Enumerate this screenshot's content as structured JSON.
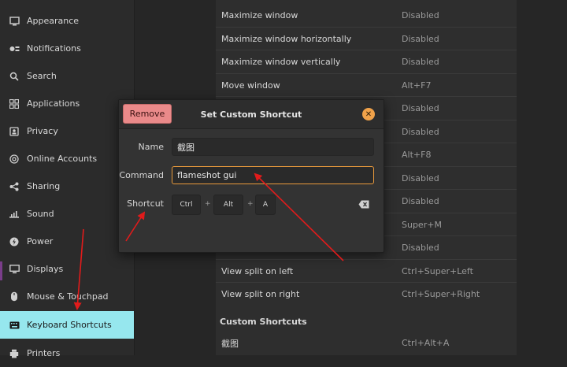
{
  "sidebar": {
    "items": [
      {
        "label": "Appearance",
        "icon": "appearance-icon",
        "active": false
      },
      {
        "label": "Notifications",
        "icon": "notifications-icon",
        "active": false
      },
      {
        "label": "Search",
        "icon": "search-icon",
        "active": false
      },
      {
        "label": "Applications",
        "icon": "applications-icon",
        "active": false
      },
      {
        "label": "Privacy",
        "icon": "privacy-icon",
        "active": false
      },
      {
        "label": "Online Accounts",
        "icon": "at-icon",
        "active": false
      },
      {
        "label": "Sharing",
        "icon": "share-icon",
        "active": false
      },
      {
        "label": "Sound",
        "icon": "sound-icon",
        "active": false
      },
      {
        "label": "Power",
        "icon": "power-icon",
        "active": false
      },
      {
        "label": "Displays",
        "icon": "display-icon",
        "active": false
      },
      {
        "label": "Mouse & Touchpad",
        "icon": "mouse-icon",
        "active": false
      },
      {
        "label": "Keyboard Shortcuts",
        "icon": "keyboard-icon",
        "active": true
      },
      {
        "label": "Printers",
        "icon": "printer-icon",
        "active": false
      }
    ],
    "active_color": "#96e7ee"
  },
  "shortcuts": [
    {
      "name": "Maximize window",
      "value": "Disabled"
    },
    {
      "name": "Maximize window horizontally",
      "value": "Disabled"
    },
    {
      "name": "Maximize window vertically",
      "value": "Disabled"
    },
    {
      "name": "Move window",
      "value": "Alt+F7"
    },
    {
      "name": "",
      "value": "Disabled"
    },
    {
      "name": "",
      "value": "Disabled"
    },
    {
      "name": "",
      "value": "Alt+F8"
    },
    {
      "name": "",
      "value": "Disabled"
    },
    {
      "name": "",
      "value": "Disabled"
    },
    {
      "name": "",
      "value": "Super+M"
    },
    {
      "name": "",
      "value": "Disabled"
    },
    {
      "name": "View split on left",
      "value": "Ctrl+Super+Left"
    },
    {
      "name": "View split on right",
      "value": "Ctrl+Super+Right"
    }
  ],
  "custom": {
    "heading": "Custom Shortcuts",
    "items": [
      {
        "name": "截图",
        "value": "Ctrl+Alt+A"
      }
    ]
  },
  "dialog": {
    "title": "Set Custom Shortcut",
    "remove_label": "Remove",
    "close_icon": "close-icon",
    "remove_color": "#ea8a8a",
    "focus_color": "#e99a3c",
    "name_label": "Name",
    "name_value": "截图",
    "command_label": "Command",
    "command_value": "flameshot gui",
    "shortcut_label": "Shortcut",
    "keys": [
      "Ctrl",
      "Alt",
      "A"
    ],
    "key_separator": "+",
    "clear_icon": "backspace-icon"
  },
  "annotation_color": "#e11b1b"
}
